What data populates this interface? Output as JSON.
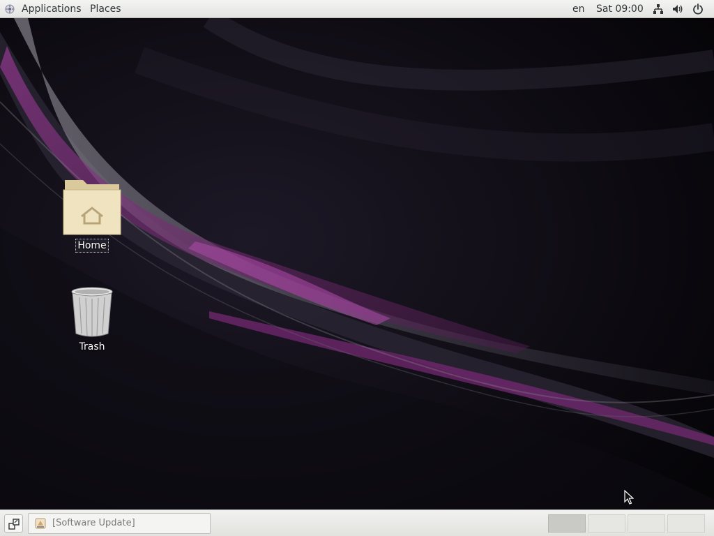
{
  "top_panel": {
    "menus": {
      "applications": "Applications",
      "places": "Places"
    },
    "keyboard_layout": "en",
    "clock": "Sat 09:00",
    "tray_icons": [
      "network-wired-icon",
      "volume-icon",
      "power-icon"
    ]
  },
  "desktop": {
    "icons": {
      "home": {
        "label": "Home",
        "icon": "home-folder-icon"
      },
      "trash": {
        "label": "Trash",
        "icon": "trash-can-icon"
      }
    },
    "colors": {
      "background": "#0b0910",
      "accent_purple": "#7a2a78",
      "streak_gray": "#8a8690"
    }
  },
  "bottom_panel": {
    "window_list": [
      {
        "label": "[Software Update]",
        "icon": "software-update-icon"
      }
    ],
    "workspaces": {
      "count": 4,
      "active": 1
    }
  }
}
